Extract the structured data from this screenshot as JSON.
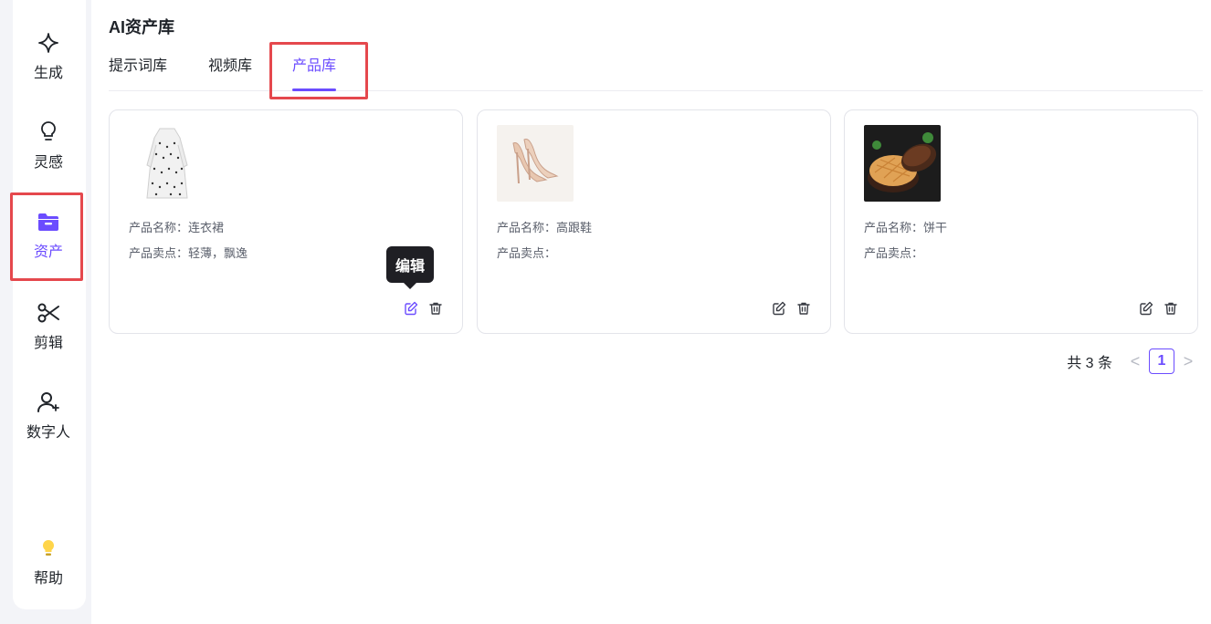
{
  "sidebar": {
    "items": [
      {
        "label": "生成",
        "icon": "sparkle-icon"
      },
      {
        "label": "灵感",
        "icon": "lightbulb-icon"
      },
      {
        "label": "资产",
        "icon": "folder-icon",
        "active": true
      },
      {
        "label": "剪辑",
        "icon": "scissors-icon"
      },
      {
        "label": "数字人",
        "icon": "user-plus-icon"
      }
    ],
    "help": {
      "label": "帮助",
      "icon": "bulb-help-icon"
    }
  },
  "page": {
    "title": "AI资产库",
    "tabs": [
      {
        "label": "提示词库"
      },
      {
        "label": "视频库"
      },
      {
        "label": "产品库",
        "active": true
      }
    ]
  },
  "products": [
    {
      "name_label": "产品名称：",
      "name": "连衣裙",
      "points_label": "产品卖点：",
      "points": "轻薄，飘逸",
      "image": "dress-image"
    },
    {
      "name_label": "产品名称：",
      "name": "高跟鞋",
      "points_label": "产品卖点：",
      "points": "",
      "image": "high-heels-image"
    },
    {
      "name_label": "产品名称：",
      "name": "饼干",
      "points_label": "产品卖点：",
      "points": "",
      "image": "cookie-image"
    }
  ],
  "tooltip": {
    "text": "编辑"
  },
  "pagination": {
    "total_text": "共 3 条",
    "current_page": "1",
    "prev": "<",
    "next": ">"
  },
  "colors": {
    "accent": "#6b4cff",
    "highlight": "#e5484d"
  }
}
